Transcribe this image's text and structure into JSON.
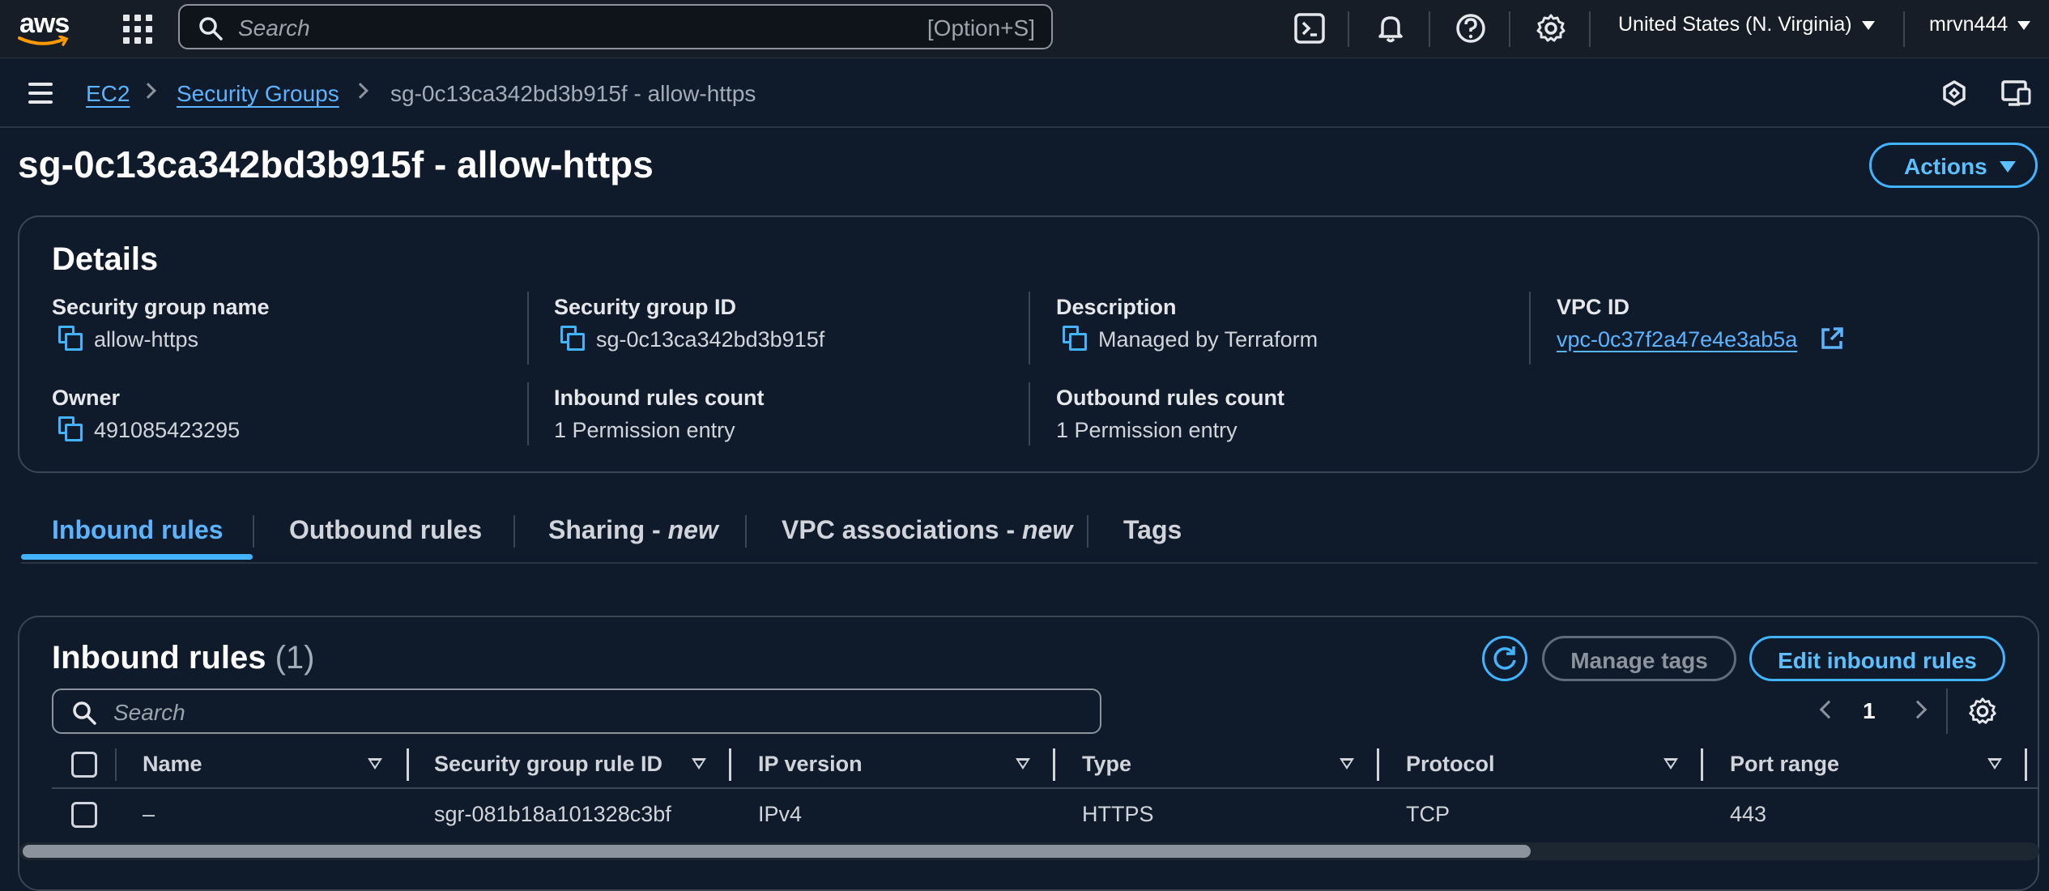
{
  "topnav": {
    "logo_text": "aws",
    "search_placeholder": "Search",
    "search_shortcut": "[Option+S]",
    "region": "United States (N. Virginia)",
    "user": "mrvn444"
  },
  "breadcrumb": {
    "items": [
      "EC2",
      "Security Groups",
      "sg-0c13ca342bd3b915f - allow-https"
    ]
  },
  "page": {
    "title": "sg-0c13ca342bd3b915f - allow-https",
    "actions_label": "Actions"
  },
  "details": {
    "title": "Details",
    "fields": {
      "sg_name_label": "Security group name",
      "sg_name_value": "allow-https",
      "sg_id_label": "Security group ID",
      "sg_id_value": "sg-0c13ca342bd3b915f",
      "description_label": "Description",
      "description_value": "Managed by Terraform",
      "vpc_id_label": "VPC ID",
      "vpc_id_value": "vpc-0c37f2a47e4e3ab5a",
      "owner_label": "Owner",
      "owner_value": "491085423295",
      "inbound_count_label": "Inbound rules count",
      "inbound_count_value": "1 Permission entry",
      "outbound_count_label": "Outbound rules count",
      "outbound_count_value": "1 Permission entry"
    }
  },
  "tabs": {
    "inbound": "Inbound rules",
    "outbound": "Outbound rules",
    "sharing": "Sharing - ",
    "sharing_new": "new",
    "vpc_assoc": "VPC associations - ",
    "vpc_assoc_new": "new",
    "tags": "Tags"
  },
  "inbound": {
    "title": "Inbound rules",
    "count": "(1)",
    "manage_tags": "Manage tags",
    "edit_rules": "Edit inbound rules",
    "search_placeholder": "Search",
    "page_number": "1",
    "columns": [
      "Name",
      "Security group rule ID",
      "IP version",
      "Type",
      "Protocol",
      "Port range"
    ],
    "rows": [
      {
        "name": "–",
        "rule_id": "sgr-081b18a101328c3bf",
        "ip_version": "IPv4",
        "type": "HTTPS",
        "protocol": "TCP",
        "port_range": "443"
      }
    ]
  },
  "colors": {
    "accent": "#42b4ff",
    "link": "#5cb3ff",
    "background": "#0f1b2a",
    "topnav": "#161d26"
  }
}
